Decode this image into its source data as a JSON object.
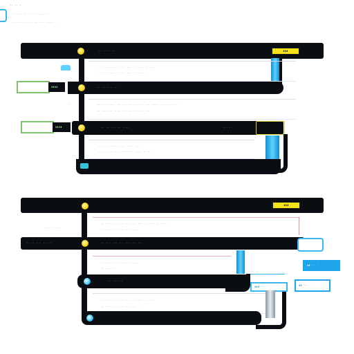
{
  "header": {
    "title": "·· ·· ·",
    "line_1": "·· ···· ·· ·· ·· ···· ··",
    "line_2": "··· ···· ·· ·· ··· ·· ···· ·"
  },
  "colors": {
    "track": "#0a0d12",
    "accent_yellow": "#f5e11a",
    "accent_blue": "#38b6f0",
    "accent_green": "#7fc46a"
  },
  "group_a": {
    "header_label": "·· ···· ··",
    "badge": "▮▮▮",
    "nodes": [
      {
        "label": "·· ·· ···· ··",
        "detail_1": "·· ···· ··· ···· ··· ·· ··· ·· ···",
        "detail_2": "··· ·· ··· ·· ·· ··· ·· ····",
        "button": "▮▮▮▮"
      },
      {
        "label": "·· ·· ··· ·· ····",
        "detail_1": "··· ·· ···· ·· ··· ·· ··· ·· ··· ···· ··· ··· ·· ·",
        "detail_2": "·· ··· ·· ···· ··· ·· ··· ·· ···",
        "button": "▮▮▮▮"
      },
      {
        "label": "·· ···· ·· ···",
        "detail_1": "··· ·· ····· ··· ···· ·· ·",
        "detail_2": "·· ··· ·· ·· ···· ··· ···· ·· ··"
      }
    ]
  },
  "group_b": {
    "header_label": "·· ··· ·· ···",
    "badge": "▮▮▮",
    "nodes": [
      {
        "label": "·· ·· ··· ·· ··",
        "detail_1": "·· ··· ·· ···· ··· ·· ··· ·· ··· ·· ··· ·",
        "detail_2": "··· ·· ···· ·· ··· ···"
      },
      {
        "label": "·· ··· ··· ·· ···· ·· ···",
        "detail_1": "··· ·· ··· ···· ·· ···",
        "detail_2": "·· ··· ··"
      },
      {
        "label": "·· ··",
        "detail_1": "··· ·· ···· ·· ··· ·· ··· ·· ···",
        "detail_2": "·· ··· ·· ···· ··· ·· ·"
      }
    ],
    "chips": [
      "▮▮ ·· ·",
      "▮▮▮ ··",
      "▮▮ ··· ·"
    ]
  }
}
